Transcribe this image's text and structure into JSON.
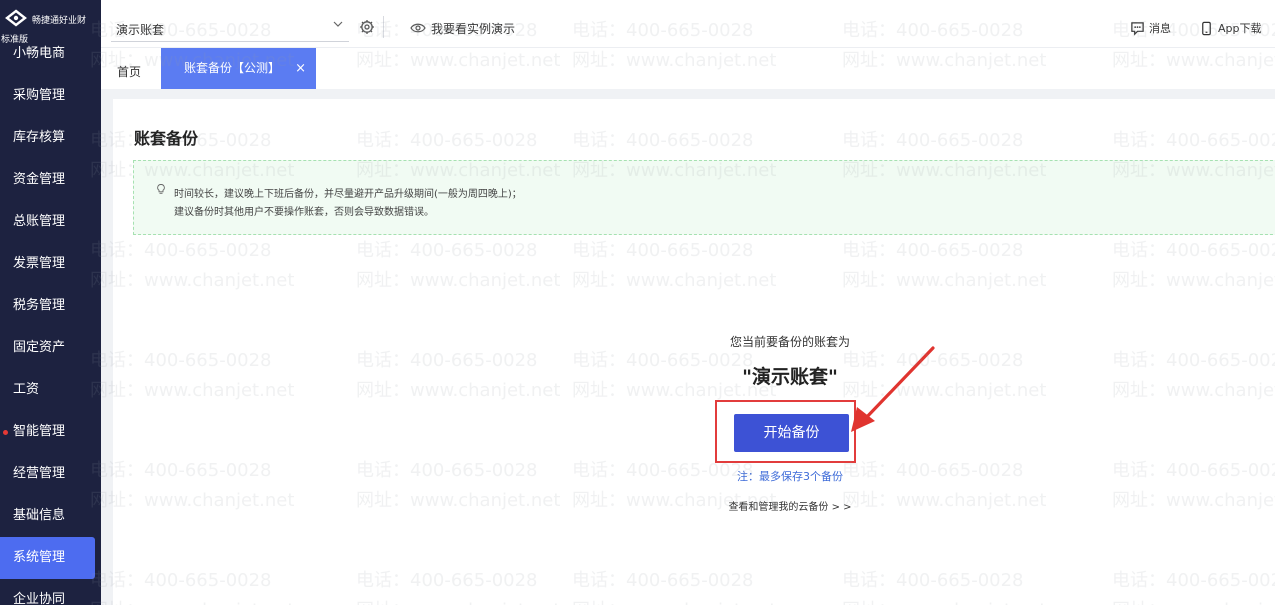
{
  "brand": {
    "name": "畅捷通好业财",
    "edition": "标准版"
  },
  "sidebar": {
    "items": [
      {
        "label": "小畅电商"
      },
      {
        "label": "采购管理"
      },
      {
        "label": "库存核算"
      },
      {
        "label": "资金管理"
      },
      {
        "label": "总账管理"
      },
      {
        "label": "发票管理"
      },
      {
        "label": "税务管理"
      },
      {
        "label": "固定资产"
      },
      {
        "label": "工资"
      },
      {
        "label": "智能管理"
      },
      {
        "label": "经营管理"
      },
      {
        "label": "基础信息"
      },
      {
        "label": "系统管理"
      },
      {
        "label": "企业协同"
      }
    ],
    "active_index": 12,
    "dot_index": 9,
    "dot_color": "#e53935",
    "active_color": "#4d6cf0"
  },
  "topbar": {
    "account_selected": "演示账套",
    "demo_link": "我要看实例演示",
    "messages": "消息",
    "app_download": "App下载"
  },
  "tabs": {
    "home": "首页",
    "active": "账套备份【公测】",
    "close_glyph": "×"
  },
  "page": {
    "title": "账套备份",
    "notice_line1": "时间较长，建议晚上下班后备份，并尽量避开产品升级期间(一般为周四晚上)；",
    "notice_line2": "建议备份时其他用户不要操作账套，否则会导致数据错误。",
    "backup_prompt": "您当前要备份的账套为",
    "backup_account": "\"演示账套\"",
    "start_button": "开始备份",
    "note": "注：最多保存3个备份",
    "cloud_link": "查看和管理我的云备份 > >"
  },
  "watermark": {
    "phone": "电话：400-665-0028",
    "site": "网址：www.chanjet.net"
  },
  "colors": {
    "sidebar_bg": "#1d2240",
    "tab_active": "#5b7cf2",
    "primary_button": "#3d52d5",
    "highlight_red": "#e23c3c",
    "notice_bg": "#f1fbf3",
    "note_blue": "#3d6bd8"
  },
  "icons": {
    "brand": "brand-logo-icon",
    "chevron": "chevron-down-icon",
    "settings": "gear-icon",
    "demo": "eye-icon",
    "messages": "message-icon",
    "app": "phone-icon",
    "tip": "lightbulb-icon",
    "annotation": "red-arrow-icon"
  }
}
